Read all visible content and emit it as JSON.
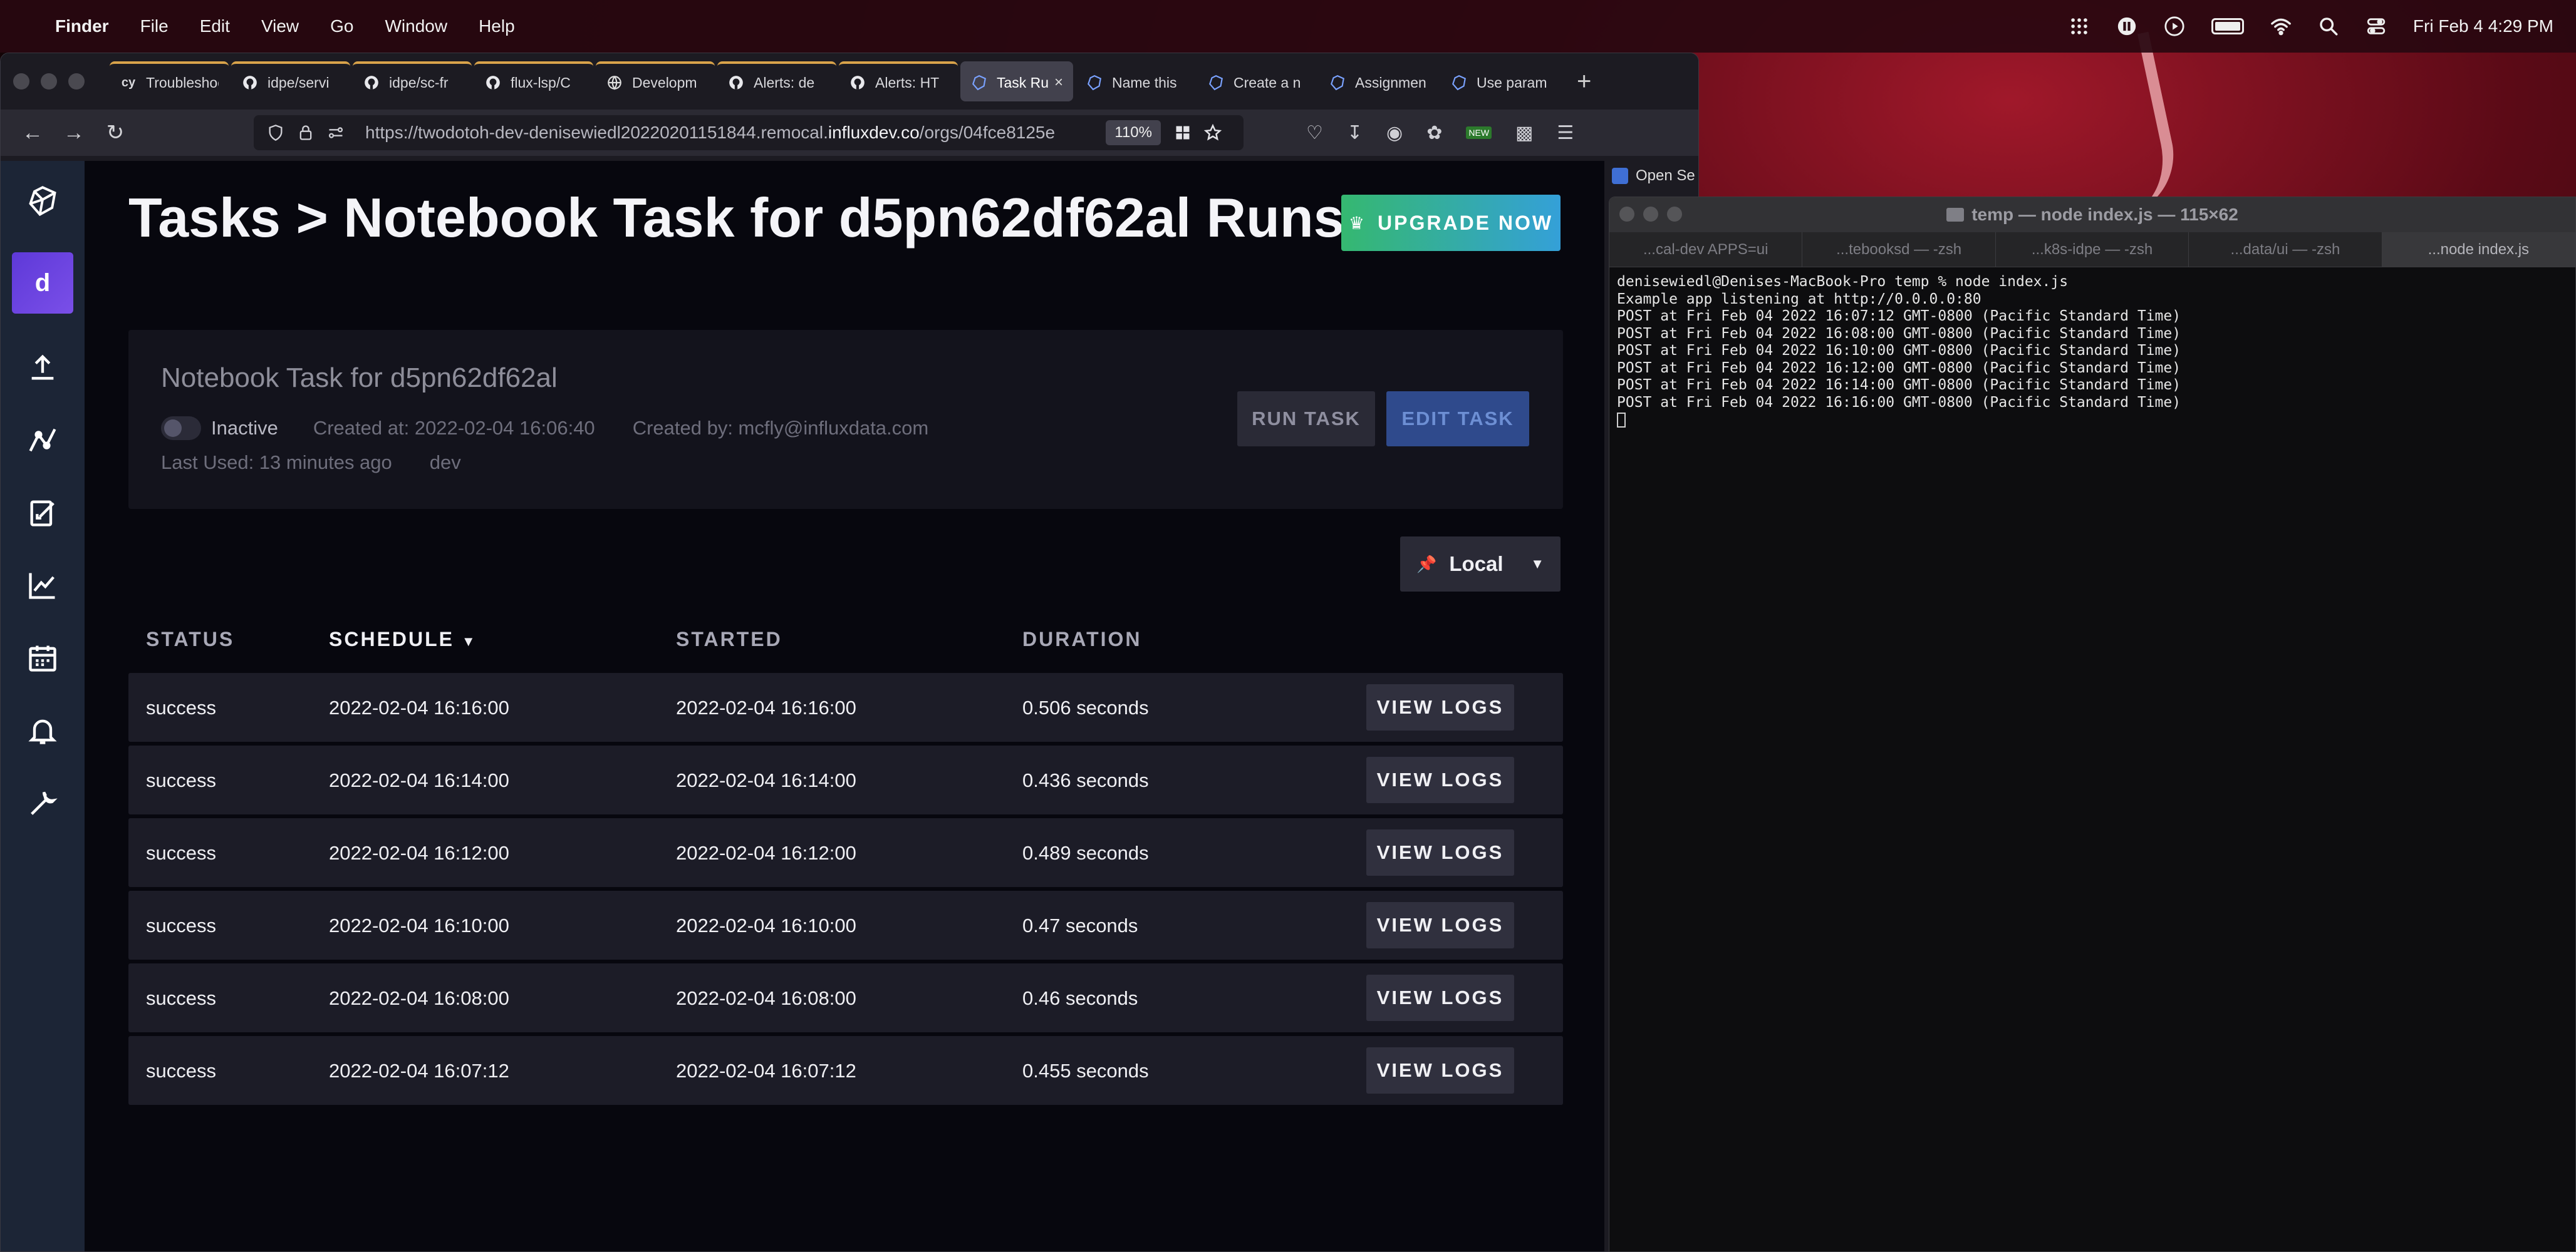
{
  "menubar": {
    "app_name": "Finder",
    "menus": [
      "File",
      "Edit",
      "View",
      "Go",
      "Window",
      "Help"
    ],
    "clock": "Fri Feb 4  4:29 PM"
  },
  "browser": {
    "tabs": [
      {
        "label": "Troubleshoot",
        "icon": "cy-favicon",
        "accent": "#d9a34a"
      },
      {
        "label": "idpe/servi",
        "icon": "github-icon",
        "accent": "#d9a34a"
      },
      {
        "label": "idpe/sc-fr",
        "icon": "github-icon",
        "accent": "#d9a34a"
      },
      {
        "label": "flux-lsp/C",
        "icon": "github-icon",
        "accent": "#d9a34a"
      },
      {
        "label": "Developm",
        "icon": "globe-icon",
        "accent": "#d9a34a"
      },
      {
        "label": "Alerts: de",
        "icon": "github-icon",
        "accent": "#d9a34a"
      },
      {
        "label": "Alerts: HT",
        "icon": "github-icon",
        "accent": "#d9a34a"
      },
      {
        "label": "Task Ru",
        "icon": "influx-icon",
        "active": true
      },
      {
        "label": "Name this",
        "icon": "influx-icon"
      },
      {
        "label": "Create a n",
        "icon": "influx-icon"
      },
      {
        "label": "Assignmen",
        "icon": "influx-icon"
      },
      {
        "label": "Use param",
        "icon": "influx-icon"
      }
    ],
    "url_prefix": "https://twodotoh-dev-denisewiedl20220201151844.remocal.",
    "url_domain": "influxdev.co",
    "url_suffix": "/orgs/04fce8125e",
    "zoom": "110%",
    "new_badge": "NEW",
    "bookmark_label": "Open Se"
  },
  "sidebar": {
    "org_initial": "d",
    "items": [
      "influx-logo-icon",
      "upload-icon",
      "data-explorer-icon",
      "notebook-icon",
      "dashboards-icon",
      "tasks-icon",
      "alerts-icon",
      "settings-icon"
    ]
  },
  "page": {
    "title": "Tasks > Notebook Task for d5pn62df62al Runs",
    "upgrade_label": "UPGRADE NOW"
  },
  "task": {
    "name": "Notebook Task for d5pn62df62al",
    "status": "Inactive",
    "created_at": "Created at: 2022-02-04 16:06:40",
    "created_by": "Created by: mcfly@influxdata.com",
    "last_used": "Last Used: 13 minutes ago",
    "org": "dev",
    "run_label": "RUN TASK",
    "edit_label": "EDIT TASK"
  },
  "timezone": {
    "label": "Local"
  },
  "table": {
    "headers": [
      "STATUS",
      "SCHEDULE",
      "STARTED",
      "DURATION"
    ],
    "action_label": "VIEW LOGS",
    "rows": [
      {
        "status": "success",
        "schedule": "2022-02-04 16:16:00",
        "started": "2022-02-04 16:16:00",
        "duration": "0.506 seconds"
      },
      {
        "status": "success",
        "schedule": "2022-02-04 16:14:00",
        "started": "2022-02-04 16:14:00",
        "duration": "0.436 seconds"
      },
      {
        "status": "success",
        "schedule": "2022-02-04 16:12:00",
        "started": "2022-02-04 16:12:00",
        "duration": "0.489 seconds"
      },
      {
        "status": "success",
        "schedule": "2022-02-04 16:10:00",
        "started": "2022-02-04 16:10:00",
        "duration": "0.47 seconds"
      },
      {
        "status": "success",
        "schedule": "2022-02-04 16:08:00",
        "started": "2022-02-04 16:08:00",
        "duration": "0.46 seconds"
      },
      {
        "status": "success",
        "schedule": "2022-02-04 16:07:12",
        "started": "2022-02-04 16:07:12",
        "duration": "0.455 seconds"
      }
    ]
  },
  "terminal": {
    "title": "temp — node index.js — 115×62",
    "tabs": [
      "...cal-dev APPS=ui",
      "...tebooksd — -zsh",
      "...k8s-idpe — -zsh",
      "...data/ui — -zsh",
      "...node index.js"
    ],
    "lines": [
      "denisewiedl@Denises-MacBook-Pro temp % node index.js",
      "Example app listening at http://0.0.0.0:80",
      "POST at Fri Feb 04 2022 16:07:12 GMT-0800 (Pacific Standard Time)",
      "POST at Fri Feb 04 2022 16:08:00 GMT-0800 (Pacific Standard Time)",
      "POST at Fri Feb 04 2022 16:10:00 GMT-0800 (Pacific Standard Time)",
      "POST at Fri Feb 04 2022 16:12:00 GMT-0800 (Pacific Standard Time)",
      "POST at Fri Feb 04 2022 16:14:00 GMT-0800 (Pacific Standard Time)",
      "POST at Fri Feb 04 2022 16:16:00 GMT-0800 (Pacific Standard Time)"
    ]
  }
}
